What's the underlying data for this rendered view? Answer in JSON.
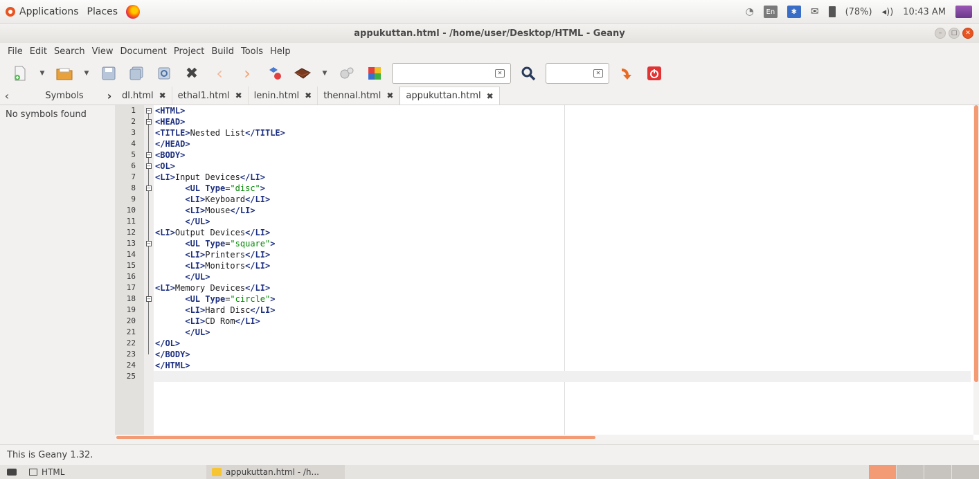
{
  "top_panel": {
    "applications": "Applications",
    "places": "Places",
    "tray": {
      "keyboard": "En",
      "battery": "(78%)",
      "clock": "10:43 AM"
    }
  },
  "window": {
    "title": "appukuttan.html - /home/user/Desktop/HTML - Geany"
  },
  "menu": [
    "File",
    "Edit",
    "Search",
    "View",
    "Document",
    "Project",
    "Build",
    "Tools",
    "Help"
  ],
  "toolbar": {
    "search_value": "",
    "goto_value": ""
  },
  "sidebar": {
    "tab": "Symbols",
    "message": "No symbols found"
  },
  "tabs": [
    "dl.html",
    "ethal1.html",
    "lenin.html",
    "thennal.html",
    "appukuttan.html"
  ],
  "active_tab": "appukuttan.html",
  "editor": {
    "lines": [
      "<HTML>",
      "<HEAD>",
      "<TITLE>Nested List</TITLE>",
      "</HEAD>",
      "<BODY>",
      "<OL>",
      "<LI>Input Devices</LI>",
      "      <UL Type=\"disc\">",
      "      <LI>Keyboard</LI>",
      "      <LI>Mouse</LI>",
      "      </UL>",
      "<LI>Output Devices</LI>",
      "      <UL Type=\"square\">",
      "      <LI>Printers</LI>",
      "      <LI>Monitors</LI>",
      "      </UL>",
      "<LI>Memory Devices</LI>",
      "      <UL Type=\"circle\">",
      "      <LI>Hard Disc</LI>",
      "      <LI>CD Rom</LI>",
      "      </UL>",
      "</OL>",
      "</BODY>",
      "</HTML>",
      ""
    ]
  },
  "status": "This is Geany 1.32.",
  "taskbar": {
    "folder": "HTML",
    "app": "appukuttan.html - /h..."
  }
}
